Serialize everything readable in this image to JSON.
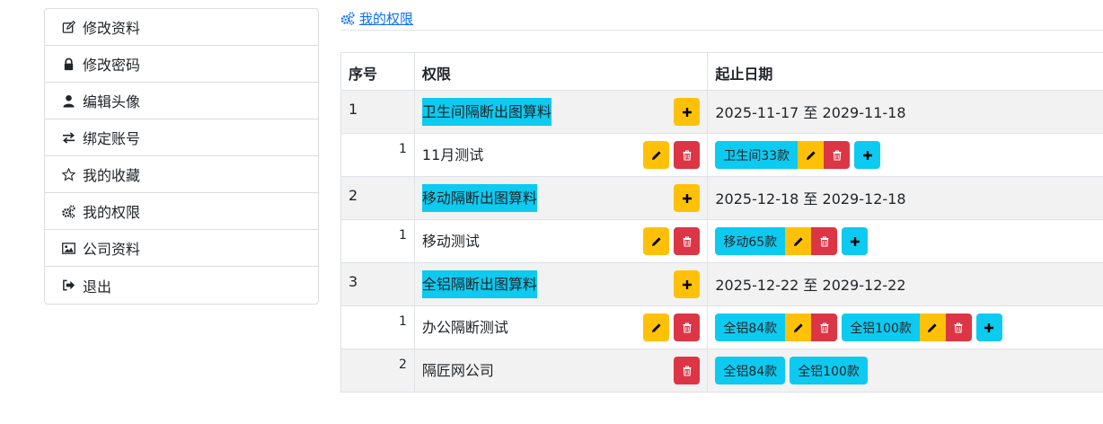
{
  "sidebar": {
    "items": [
      {
        "label": "修改资料",
        "icon": "edit-icon"
      },
      {
        "label": "修改密码",
        "icon": "lock-icon"
      },
      {
        "label": "编辑头像",
        "icon": "user-icon"
      },
      {
        "label": "绑定账号",
        "icon": "exchange-icon"
      },
      {
        "label": "我的收藏",
        "icon": "star-icon"
      },
      {
        "label": "我的权限",
        "icon": "gears-icon"
      },
      {
        "label": "公司资料",
        "icon": "image-icon"
      },
      {
        "label": "退出",
        "icon": "sign-out-icon"
      }
    ]
  },
  "breadcrumb": {
    "label": " 我的权限",
    "icon": "gears-icon"
  },
  "table": {
    "headers": {
      "no": "序号",
      "perm": "权限",
      "date": "起止日期"
    },
    "rows": [
      {
        "no": "1",
        "perm": "卫生间隔断出图算料",
        "date": "2025-11-17 至 2029-11-18",
        "subs": [
          {
            "no": "1",
            "name": "11月测试",
            "tags": [
              "卫生间33款"
            ]
          }
        ]
      },
      {
        "no": "2",
        "perm": "移动隔断出图算料",
        "date": "2025-12-18 至 2029-12-18",
        "subs": [
          {
            "no": "1",
            "name": "移动测试",
            "tags": [
              "移动65款"
            ]
          }
        ]
      },
      {
        "no": "3",
        "perm": "全铝隔断出图算料",
        "date": "2025-12-22 至 2029-12-22",
        "subs": [
          {
            "no": "1",
            "name": "办公隔断测试",
            "tags": [
              "全铝84款",
              "全铝100款"
            ]
          },
          {
            "no": "2",
            "name": "隔匠网公司",
            "tags": [
              "全铝84款",
              "全铝100款"
            ]
          }
        ]
      }
    ]
  },
  "colors": {
    "info": "#0dcaf0",
    "warning": "#ffc107",
    "danger": "#dc3545",
    "link": "#0d6efd"
  }
}
